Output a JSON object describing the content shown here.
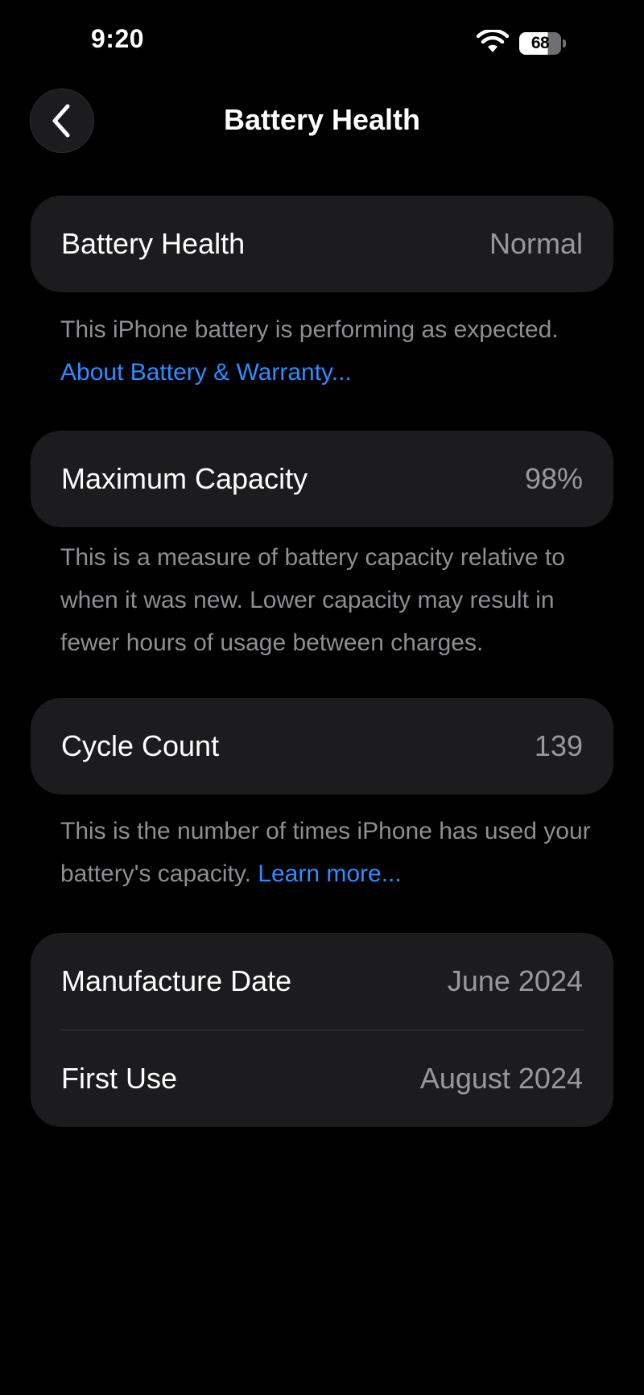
{
  "status_bar": {
    "time": "9:20",
    "battery_level": "68",
    "icons": [
      "wifi-icon",
      "battery-icon"
    ]
  },
  "nav": {
    "title": "Battery Health",
    "back_icon": "chevron-left-icon"
  },
  "battery_health": {
    "label": "Battery Health",
    "value": "Normal",
    "note_text": "This iPhone battery is performing as expected. ",
    "note_link": "About Battery & Warranty..."
  },
  "max_capacity": {
    "label": "Maximum Capacity",
    "value": "98%",
    "note_text": "This is a measure of battery capacity relative to when it was new. Lower capacity may result in fewer hours of usage between charges."
  },
  "cycle_count": {
    "label": "Cycle Count",
    "value": "139",
    "note_text": "This is the number of times iPhone has used your battery's capacity. ",
    "note_link": "Learn more..."
  },
  "dates": {
    "manufacture_label": "Manufacture Date",
    "manufacture_value": "June 2024",
    "first_use_label": "First Use",
    "first_use_value": "August 2024"
  },
  "colors": {
    "background": "#000000",
    "card": "#1c1c1e",
    "secondary_text": "#8e8e93",
    "link": "#2f8cff"
  }
}
